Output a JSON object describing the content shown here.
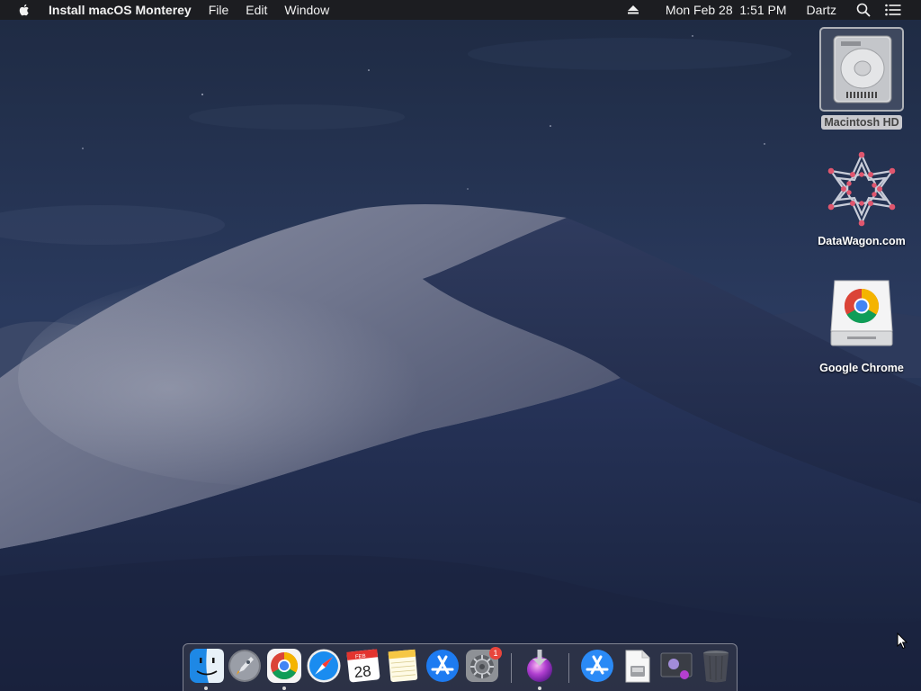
{
  "menubar": {
    "app_name": "Install macOS Monterey",
    "menus": [
      "File",
      "Edit",
      "Window"
    ],
    "datetime": "Mon Feb 28  1:51 PM",
    "user": "Dartz"
  },
  "desktop": {
    "icons": [
      {
        "label": "Macintosh HD",
        "icon": "hard-drive-icon",
        "selected": true
      },
      {
        "label": "DataWagon.com",
        "icon": "datawagon-disk-icon",
        "selected": false
      },
      {
        "label": "Google Chrome",
        "icon": "chrome-disk-image-icon",
        "selected": false
      }
    ]
  },
  "dock": {
    "items": [
      {
        "name": "Finder",
        "icon": "finder-icon",
        "running": true
      },
      {
        "name": "Launchpad",
        "icon": "launchpad-icon",
        "running": false
      },
      {
        "name": "Google Chrome",
        "icon": "chrome-icon",
        "running": true
      },
      {
        "name": "Safari",
        "icon": "safari-icon",
        "running": false
      },
      {
        "name": "Calendar",
        "icon": "calendar-icon",
        "running": false,
        "month": "FEB",
        "day": "28"
      },
      {
        "name": "Notes",
        "icon": "notes-icon",
        "running": false
      },
      {
        "name": "App Store",
        "icon": "app-store-icon",
        "running": false
      },
      {
        "name": "System Preferences",
        "icon": "system-preferences-icon",
        "running": false,
        "badge": "1"
      },
      {
        "name": "Install macOS Monterey",
        "icon": "install-macos-icon",
        "running": true
      },
      {
        "name": "Applications",
        "icon": "applications-folder-icon",
        "running": false
      },
      {
        "name": "Document",
        "icon": "document-icon",
        "running": false
      },
      {
        "name": "Screenshot",
        "icon": "screenshot-icon",
        "running": false
      },
      {
        "name": "Trash",
        "icon": "trash-icon",
        "running": false
      }
    ]
  },
  "colors": {
    "menubar_bg": "#1c1c1e",
    "badge_red": "#e8453c",
    "wallpaper_sky": "#24314f"
  }
}
